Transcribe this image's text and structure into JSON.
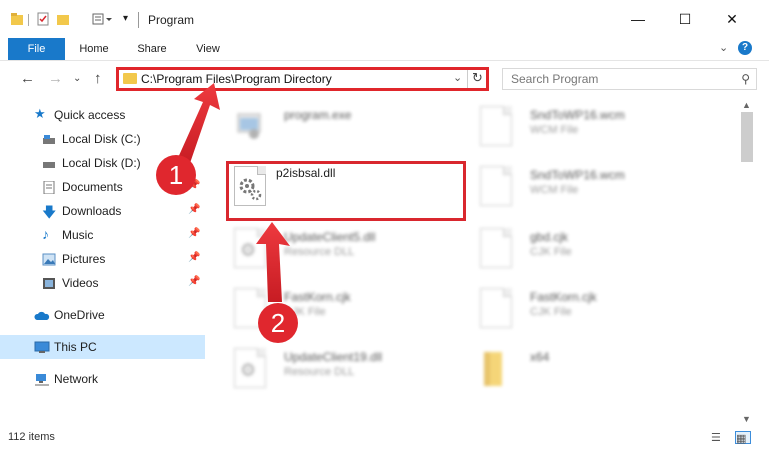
{
  "window": {
    "title": "Program",
    "minimize_icon": "minimize-icon",
    "maximize_icon": "maximize-icon",
    "close_icon": "close-icon"
  },
  "ribbon": {
    "tabs": [
      "File",
      "Home",
      "Share",
      "View"
    ],
    "help_label": "?"
  },
  "address": {
    "path": "C:\\Program Files\\Program Directory"
  },
  "search": {
    "placeholder": "Search Program"
  },
  "sidebar": {
    "items": [
      {
        "label": "Quick access",
        "icon": "star-icon"
      },
      {
        "label": "Local Disk (C:)",
        "icon": "drive-icon"
      },
      {
        "label": "Local Disk (D:)",
        "icon": "drive-icon"
      },
      {
        "label": "Documents",
        "icon": "documents-icon"
      },
      {
        "label": "Downloads",
        "icon": "downloads-icon"
      },
      {
        "label": "Music",
        "icon": "music-icon"
      },
      {
        "label": "Pictures",
        "icon": "pictures-icon"
      },
      {
        "label": "Videos",
        "icon": "videos-icon"
      },
      {
        "label": "OneDrive",
        "icon": "cloud-icon"
      },
      {
        "label": "This PC",
        "icon": "computer-icon"
      },
      {
        "label": "Network",
        "icon": "network-icon"
      }
    ]
  },
  "files": [
    {
      "name": "program.exe",
      "type": ""
    },
    {
      "name": "p2isbsal.dll",
      "type": ""
    },
    {
      "name": "UpdateClient5.dll",
      "type": "Resource DLL"
    },
    {
      "name": "FastKorn.cjk",
      "type": "CJK File"
    },
    {
      "name": "UpdateClient19.dll",
      "type": "Resource DLL"
    },
    {
      "name": "SndToWP16.wcm",
      "type": "WCM File"
    },
    {
      "name": "SndToWP16.wcm",
      "type": "WCM File"
    },
    {
      "name": "gbd.cjk",
      "type": "CJK File"
    },
    {
      "name": "FastKorn.cjk",
      "type": "CJK File"
    },
    {
      "name": "x64",
      "type": ""
    }
  ],
  "callouts": [
    "1",
    "2"
  ],
  "status": {
    "item_count": "112 items"
  },
  "colors": {
    "accent": "#1979ca",
    "highlight": "#e0262b",
    "selected": "#cce8ff",
    "folder": "#f2c84b"
  }
}
